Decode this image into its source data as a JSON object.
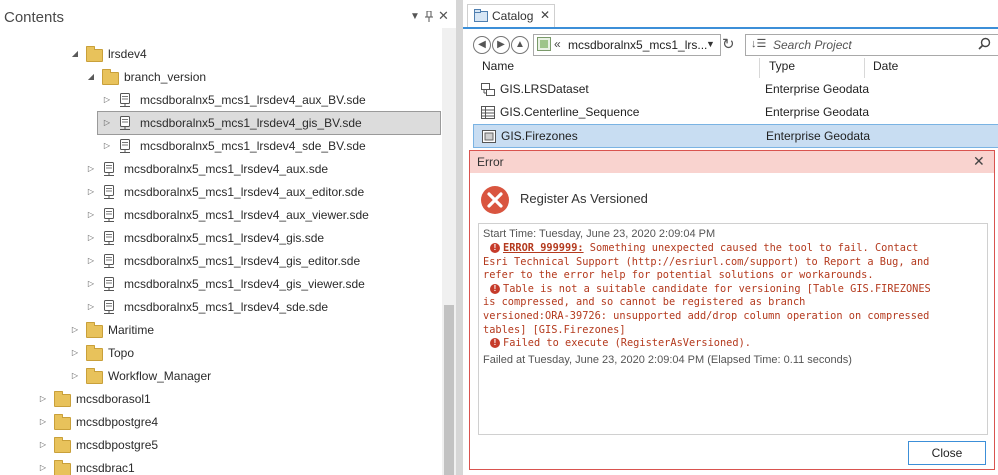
{
  "contents": {
    "title": "Contents",
    "tree": [
      {
        "label": "lrsdev4",
        "type": "folder",
        "level": 4,
        "expanded": true
      },
      {
        "label": "branch_version",
        "type": "folder",
        "level": 5,
        "expanded": true
      },
      {
        "label": "mcsdboralnx5_mcs1_lrsdev4_aux_BV.sde",
        "type": "db",
        "level": 6
      },
      {
        "label": "mcsdboralnx5_mcs1_lrsdev4_gis_BV.sde",
        "type": "db",
        "level": 6,
        "selected": true
      },
      {
        "label": "mcsdboralnx5_mcs1_lrsdev4_sde_BV.sde",
        "type": "db",
        "level": 6
      },
      {
        "label": "mcsdboralnx5_mcs1_lrsdev4_aux.sde",
        "type": "db",
        "level": 5
      },
      {
        "label": "mcsdboralnx5_mcs1_lrsdev4_aux_editor.sde",
        "type": "db",
        "level": 5
      },
      {
        "label": "mcsdboralnx5_mcs1_lrsdev4_aux_viewer.sde",
        "type": "db",
        "level": 5
      },
      {
        "label": "mcsdboralnx5_mcs1_lrsdev4_gis.sde",
        "type": "db",
        "level": 5
      },
      {
        "label": "mcsdboralnx5_mcs1_lrsdev4_gis_editor.sde",
        "type": "db",
        "level": 5
      },
      {
        "label": "mcsdboralnx5_mcs1_lrsdev4_gis_viewer.sde",
        "type": "db",
        "level": 5
      },
      {
        "label": "mcsdboralnx5_mcs1_lrsdev4_sde.sde",
        "type": "db",
        "level": 5
      },
      {
        "label": "Maritime",
        "type": "folder",
        "level": 4
      },
      {
        "label": "Topo",
        "type": "folder",
        "level": 4
      },
      {
        "label": "Workflow_Manager",
        "type": "folder",
        "level": 4
      },
      {
        "label": "mcsdborasol1",
        "type": "folder",
        "level": 2
      },
      {
        "label": "mcsdbpostgre4",
        "type": "folder",
        "level": 2
      },
      {
        "label": "mcsdbpostgre5",
        "type": "folder",
        "level": 2
      },
      {
        "label": "mcsdbrac1",
        "type": "folder",
        "level": 2
      }
    ]
  },
  "catalog": {
    "tab_label": "Catalog",
    "path": "mcsdboralnx5_mcs1_lrs...",
    "path_prefix": "«",
    "search_placeholder": "Search Project",
    "columns": [
      "Name",
      "Type",
      "Date"
    ],
    "rows": [
      {
        "name": "GIS.LRSDataset",
        "type": "Enterprise Geodata",
        "icon": "dataset-icon"
      },
      {
        "name": "GIS.Centerline_Sequence",
        "type": "Enterprise Geodata",
        "icon": "table-icon"
      },
      {
        "name": "GIS.Firezones",
        "type": "Enterprise Geodata",
        "icon": "featureclass-icon",
        "selected": true
      }
    ]
  },
  "dialog": {
    "title": "Error",
    "heading": "Register As Versioned",
    "start_time": "Start Time: Tuesday, June 23, 2020 2:09:04 PM",
    "err1_code": "ERROR 999999:",
    "err1_line1": " Something unexpected caused the tool to fail. Contact",
    "err1_line2": "Esri Technical Support (http://esriurl.com/support) to Report a Bug, and",
    "err1_line3": "refer to the error help for potential solutions or workarounds.",
    "err2_line1": "Table is not a suitable candidate for versioning [Table GIS.FIREZONES",
    "err2_line2": "is compressed, and so cannot be registered as branch",
    "err2_line3": "versioned:ORA-39726: unsupported add/drop column operation on compressed",
    "err2_line4": "tables] [GIS.Firezones]",
    "err3_line1": "Failed to execute (RegisterAsVersioned).",
    "failed_at": "Failed at Tuesday, June 23, 2020 2:09:04 PM (Elapsed Time: 0.11 seconds)",
    "close_label": "Close",
    "bullet_glyph": "!"
  },
  "colors": {
    "error": "#c63b2a",
    "accent": "#3c8fd8",
    "selection": "#c8ddf2"
  }
}
